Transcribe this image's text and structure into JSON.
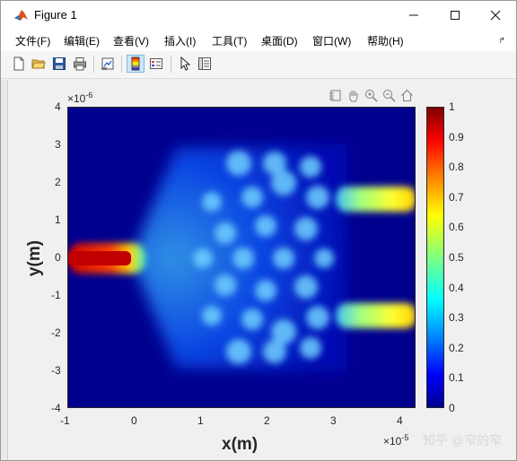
{
  "window": {
    "title": "Figure 1",
    "minimize_icon": "minimize-icon",
    "maximize_icon": "maximize-icon",
    "close_icon": "close-icon"
  },
  "menu": {
    "items": [
      "文件(F)",
      "编辑(E)",
      "查看(V)",
      "插入(I)",
      "工具(T)",
      "桌面(D)",
      "窗口(W)",
      "帮助(H)"
    ],
    "overflow_icon": "dock-arrow-icon"
  },
  "toolbar": {
    "buttons": [
      "new-figure-icon",
      "open-file-icon",
      "save-icon",
      "print-icon",
      "link-plot-icon",
      "insert-colorbar-icon",
      "insert-legend-icon",
      "edit-plot-icon",
      "property-inspector-icon"
    ]
  },
  "axes_toolbar": {
    "buttons": [
      "brush-icon",
      "pan-icon",
      "zoom-in-icon",
      "zoom-out-icon",
      "home-icon"
    ]
  },
  "chart_data": {
    "type": "heatmap",
    "title": "",
    "xlabel": "x(m)",
    "ylabel": "y(m)",
    "x_ticks": [
      "-1",
      "0",
      "1",
      "2",
      "3",
      "4"
    ],
    "y_ticks": [
      "4",
      "3",
      "2",
      "1",
      "0",
      "-1",
      "-2",
      "-3",
      "-4"
    ],
    "x_exponent": "-5",
    "y_exponent": "-6",
    "xlim": [
      -1e-05,
      4.25e-05
    ],
    "ylim": [
      -4e-06,
      4e-06
    ],
    "colormap": "jet",
    "clim": [
      0,
      1
    ],
    "colorbar_ticks": [
      "1",
      "0.9",
      "0.8",
      "0.7",
      "0.6",
      "0.5",
      "0.4",
      "0.3",
      "0.2",
      "0.1",
      "0"
    ],
    "colorbar_location": "right"
  },
  "watermark": "知乎 @窄的窄"
}
